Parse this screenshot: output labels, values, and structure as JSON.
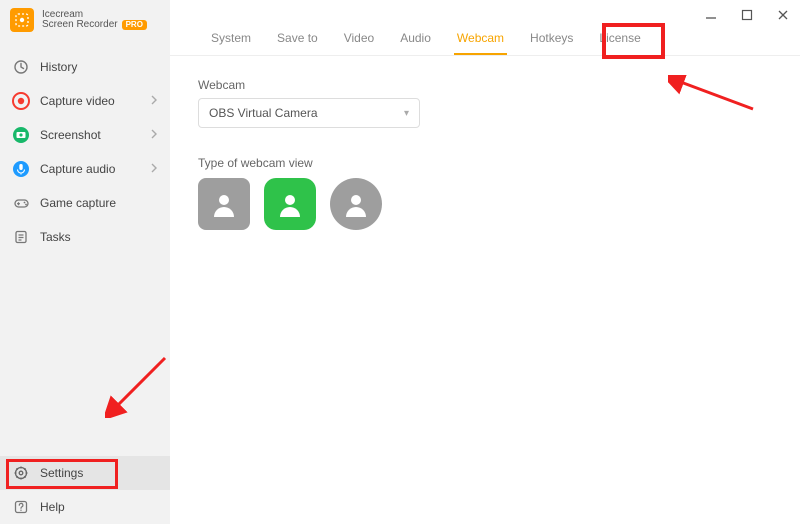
{
  "brand": {
    "line1": "Icecream",
    "line2": "Screen Recorder",
    "badge": "PRO"
  },
  "sidebar": {
    "items": [
      {
        "label": "History",
        "icon": "history"
      },
      {
        "label": "Capture video",
        "icon": "target-red",
        "chev": true
      },
      {
        "label": "Screenshot",
        "icon": "camera-green",
        "chev": true
      },
      {
        "label": "Capture audio",
        "icon": "mic-blue",
        "chev": true
      },
      {
        "label": "Game capture",
        "icon": "gamepad"
      },
      {
        "label": "Tasks",
        "icon": "tasks"
      }
    ],
    "bottom": [
      {
        "label": "Settings",
        "icon": "gear",
        "selected": true
      },
      {
        "label": "Help",
        "icon": "help"
      }
    ]
  },
  "tabs": [
    "System",
    "Save to",
    "Video",
    "Audio",
    "Webcam",
    "Hotkeys",
    "License"
  ],
  "tabs_active_index": 4,
  "webcam": {
    "label": "Webcam",
    "selected": "OBS Virtual Camera",
    "view_label": "Type of webcam view"
  }
}
